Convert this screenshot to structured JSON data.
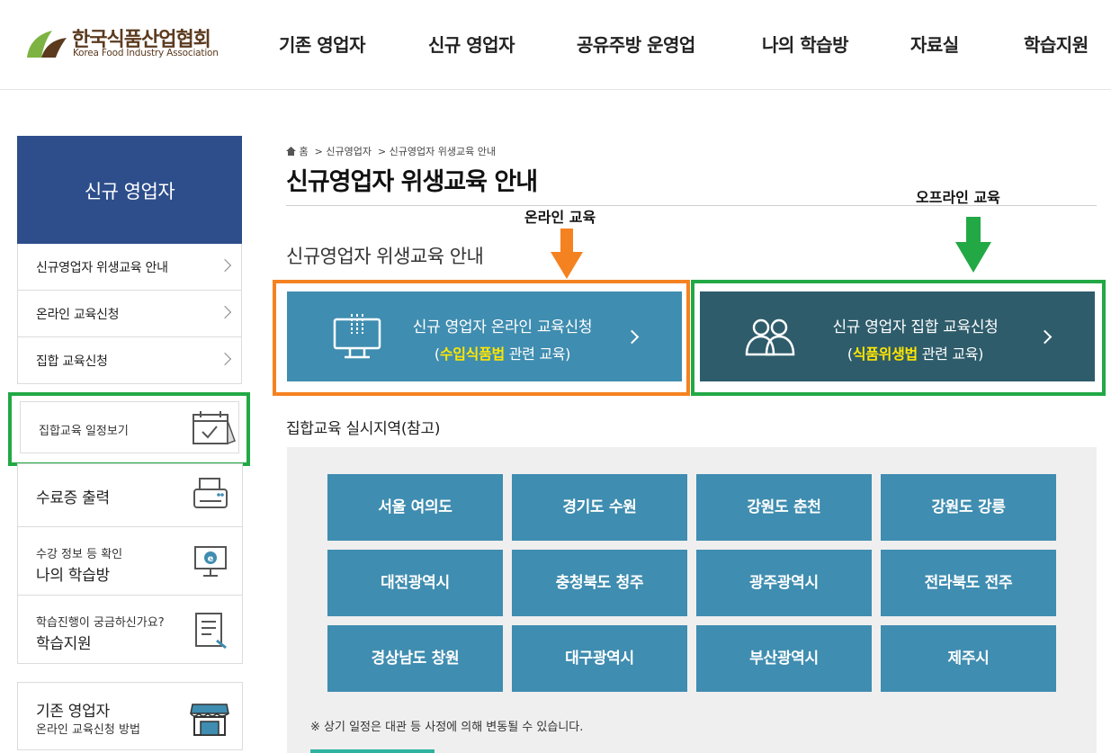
{
  "header": {
    "logo_ko": "한국식품산업협회",
    "logo_en": "Korea Food Industry Association",
    "nav": [
      "기존 영업자",
      "신규 영업자",
      "공유주방 운영업",
      "나의 학습방",
      "자료실",
      "학습지원"
    ]
  },
  "sidebar": {
    "title": "신규 영업자",
    "items": [
      "신규영업자 위생교육 안내",
      "온라인 교육신청",
      "집합 교육신청"
    ],
    "schedule": "집합교육 일정보기",
    "certificate": "수료증 출력",
    "mystudy": {
      "small": "수강 정보 등 확인",
      "big": "나의 학습방"
    },
    "support": {
      "small": "학습진행이 궁금하신가요?",
      "big": "학습지원"
    },
    "existing": {
      "big": "기존 영업자",
      "small": "온라인 교육신청 방법"
    }
  },
  "breadcrumb": {
    "home": "홈",
    "level1": "신규영업자",
    "level2": "신규영업자 위생교육 안내"
  },
  "page_title": "신규영업자 위생교육 안내",
  "section_title": "신규영업자 위생교육 안내",
  "annotations": {
    "online": "온라인 교육",
    "offline": "오프라인 교육"
  },
  "online_button": {
    "line1": "신규 영업자 온라인 교육신청",
    "open": "(",
    "highlight": "수입식품법",
    "rest": " 관련 교육)"
  },
  "offline_button": {
    "line1": "신규 영업자 집합 교육신청",
    "open": "(",
    "highlight": "식품위생법",
    "rest": " 관련 교육)"
  },
  "region_title": "집합교육 실시지역(참고)",
  "regions": [
    "서울 여의도",
    "경기도 수원",
    "강원도 춘천",
    "강원도 강릉",
    "대전광역시",
    "충청북도 청주",
    "광주광역시",
    "전라북도 전주",
    "경상남도 창원",
    "대구광역시",
    "부산광역시",
    "제주시"
  ],
  "region_note": "※ 상기 일정은 대관 등 사정에 의해 변동될 수 있습니다.",
  "colors": {
    "sidebar_title_bg": "#2d4e8b",
    "online_button": "#3f8db0",
    "offline_button": "#2e5c6b",
    "highlight_text": "#ffe600",
    "orange_frame": "#f58220",
    "green_frame": "#22a845",
    "region_button": "#3f8db0",
    "logo_brown": "#5b3a1e",
    "logo_green": "#7cb342"
  },
  "icons": {
    "logo": "leaf-logo-icon",
    "home": "home-icon",
    "online": "monitor-icon",
    "offline": "people-icon",
    "schedule": "calendar-icon",
    "certificate": "printer-icon",
    "mystudy": "e-learning-monitor-icon",
    "support": "document-pen-icon",
    "existing": "store-icon"
  }
}
